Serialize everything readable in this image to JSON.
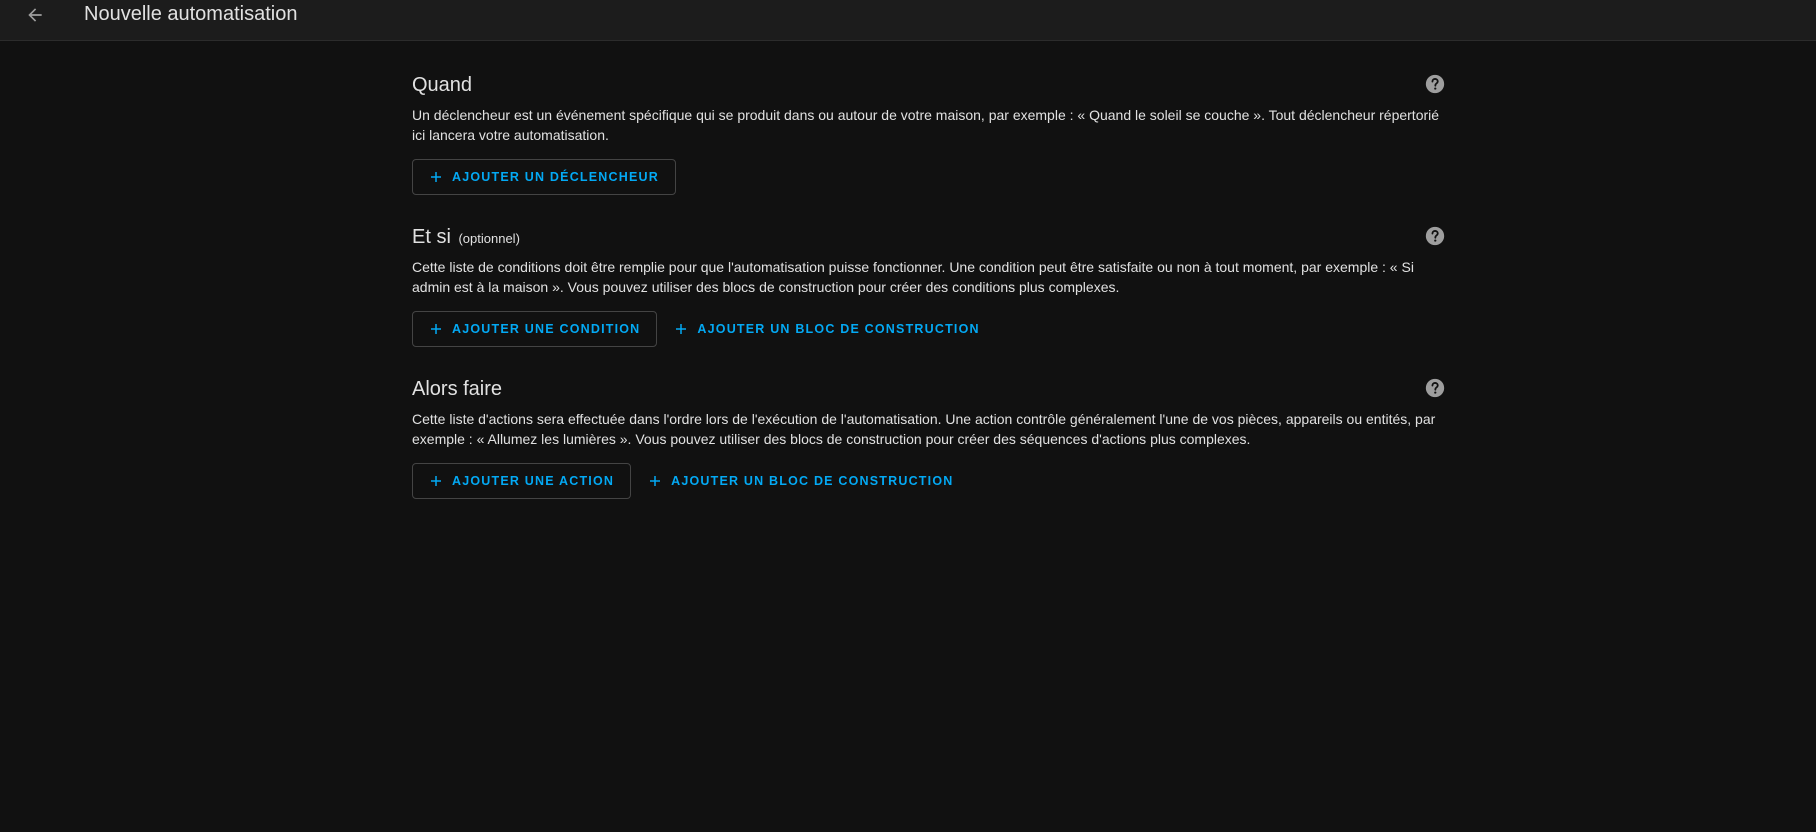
{
  "header": {
    "back_icon": "arrow-left-icon",
    "title": "Nouvelle automatisation"
  },
  "colors": {
    "background": "#111111",
    "header_background": "#1c1c1c",
    "text": "#e1e1e1",
    "accent": "#03a9f4",
    "button_border": "#444444",
    "help_icon": "#9e9e9e"
  },
  "sections": [
    {
      "title": "Quand",
      "optional": "",
      "help_icon": "help-circle-icon",
      "description": "Un déclencheur est un événement spécifique qui se produit dans ou autour de votre maison, par exemple : « Quand le soleil se couche ». Tout déclencheur répertorié ici lancera votre automatisation.",
      "buttons": [
        {
          "label": "AJOUTER UN DÉCLENCHEUR",
          "icon": "plus-icon"
        }
      ]
    },
    {
      "title": "Et si",
      "optional": "(optionnel)",
      "help_icon": "help-circle-icon",
      "description": "Cette liste de conditions doit être remplie pour que l'automatisation puisse fonctionner. Une condition peut être satisfaite ou non à tout moment, par exemple : « Si admin est à la maison ». Vous pouvez utiliser des blocs de construction pour créer des conditions plus complexes.",
      "buttons": [
        {
          "label": "AJOUTER UNE CONDITION",
          "icon": "plus-icon"
        },
        {
          "label": "AJOUTER UN BLOC DE CONSTRUCTION",
          "icon": "plus-icon"
        }
      ]
    },
    {
      "title": "Alors faire",
      "optional": "",
      "help_icon": "help-circle-icon",
      "description": "Cette liste d'actions sera effectuée dans l'ordre lors de l'exécution de l'automatisation. Une action contrôle généralement l'une de vos pièces, appareils ou entités, par exemple : « Allumez les lumières ». Vous pouvez utiliser des blocs de construction pour créer des séquences d'actions plus complexes.",
      "buttons": [
        {
          "label": "AJOUTER UNE ACTION",
          "icon": "plus-icon"
        },
        {
          "label": "AJOUTER UN BLOC DE CONSTRUCTION",
          "icon": "plus-icon"
        }
      ]
    }
  ]
}
